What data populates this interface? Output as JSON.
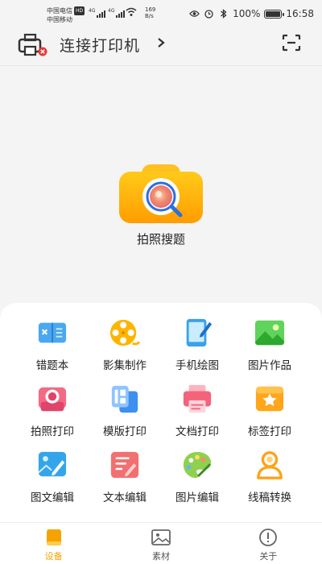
{
  "status_bar": {
    "carrier1": "中国电信",
    "carrier1_badge": "HD",
    "carrier2": "中国移动",
    "network1": "4G",
    "network2": "4G",
    "speed_value": "169",
    "speed_unit": "B/s",
    "battery": "100%",
    "time": "16:58"
  },
  "header": {
    "title": "连接打印机",
    "chevron": ">"
  },
  "main": {
    "camera_label": "拍照搜题"
  },
  "tools": [
    {
      "label": "错题本",
      "icon": "error-notebook-icon"
    },
    {
      "label": "影集制作",
      "icon": "film-reel-icon"
    },
    {
      "label": "手机绘图",
      "icon": "tablet-pen-icon"
    },
    {
      "label": "图片作品",
      "icon": "landscape-image-icon"
    },
    {
      "label": "拍照打印",
      "icon": "photo-print-icon"
    },
    {
      "label": "模版打印",
      "icon": "template-print-icon"
    },
    {
      "label": "文档打印",
      "icon": "document-print-icon"
    },
    {
      "label": "标签打印",
      "icon": "label-print-icon"
    },
    {
      "label": "图文编辑",
      "icon": "image-text-edit-icon"
    },
    {
      "label": "文本编辑",
      "icon": "text-edit-icon"
    },
    {
      "label": "图片编辑",
      "icon": "palette-icon"
    },
    {
      "label": "线稿转换",
      "icon": "line-art-person-icon"
    }
  ],
  "bottom_nav": [
    {
      "label": "设备",
      "active": true
    },
    {
      "label": "素材",
      "active": false
    },
    {
      "label": "关于",
      "active": false
    }
  ],
  "colors": {
    "accent": "#f5a300",
    "background": "#f4f4f4",
    "panel": "#ffffff"
  }
}
